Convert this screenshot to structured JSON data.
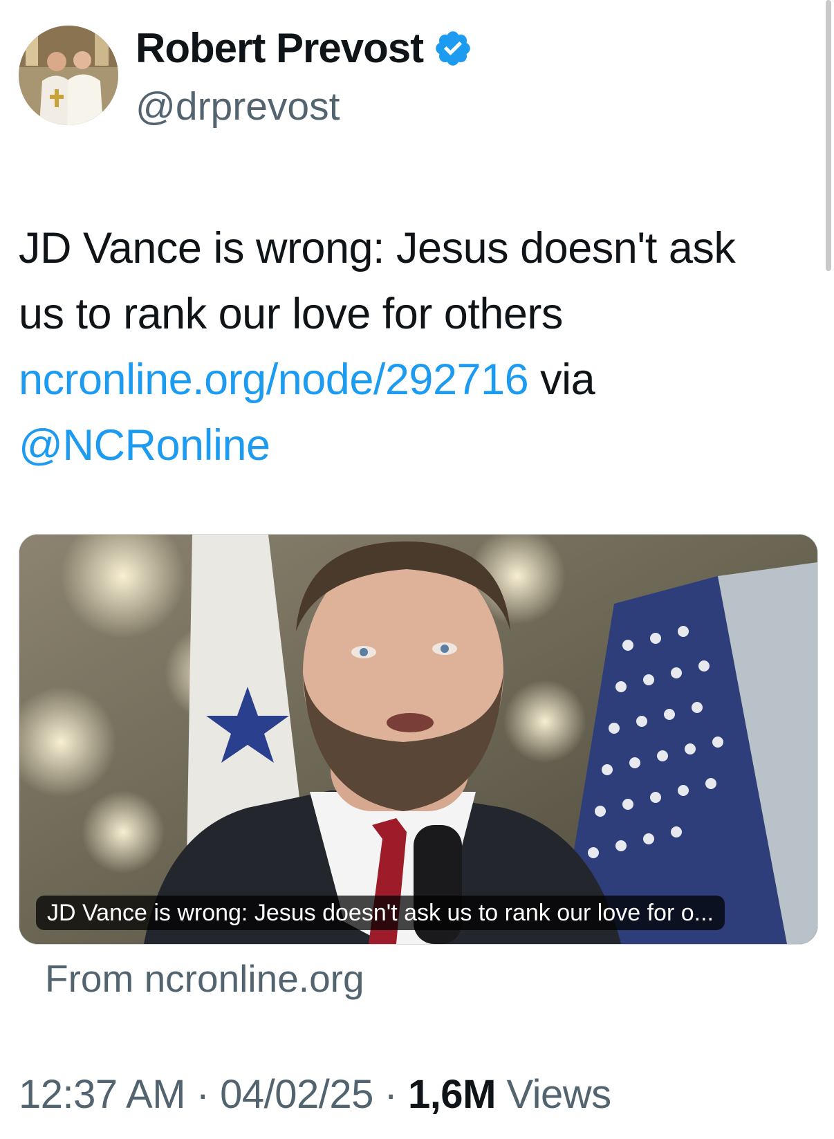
{
  "author": {
    "display_name": "Robert Prevost",
    "handle": "@drprevost",
    "verified": true,
    "avatar_icon": "avatar-photo-icon",
    "verified_icon": "verified-badge-icon",
    "verified_color": "#1d9bf0"
  },
  "tweet": {
    "text_line": "JD Vance is wrong: Jesus doesn't ask us to rank our love for others",
    "link": "ncronline.org/node/292716",
    "via": " via ",
    "mention": "@NCRonline"
  },
  "card": {
    "caption": "JD Vance is wrong: Jesus doesn't ask us to rank our love for o...",
    "source": "From ncronline.org"
  },
  "meta": {
    "time": "12:37 AM",
    "separator": " · ",
    "date": "04/02/25",
    "views_count": "1,6M",
    "views_label": " Views"
  },
  "colors": {
    "link": "#1d9bf0",
    "secondary_text": "#536471",
    "primary_text": "#0f1419"
  }
}
